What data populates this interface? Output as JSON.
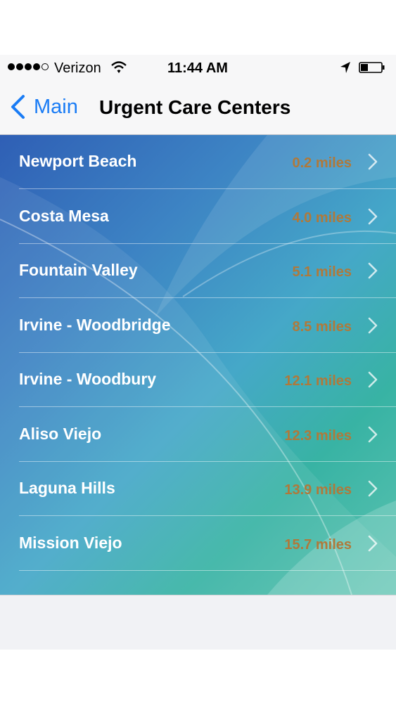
{
  "status_bar": {
    "carrier": "Verizon",
    "time": "11:44 AM",
    "signal_bars": 4,
    "icons": [
      "signal-icon",
      "wifi-icon",
      "location-arrow-icon",
      "battery-icon"
    ]
  },
  "nav": {
    "back_label": "Main",
    "title": "Urgent Care Centers"
  },
  "colors": {
    "accent": "#1a7cf5",
    "distance": "#b0793a",
    "row_text": "#ffffff"
  },
  "locations": [
    {
      "name": "Newport Beach",
      "distance": "0.2 miles"
    },
    {
      "name": "Costa Mesa",
      "distance": "4.0 miles"
    },
    {
      "name": "Fountain Valley",
      "distance": "5.1 miles"
    },
    {
      "name": "Irvine - Woodbridge",
      "distance": "8.5 miles"
    },
    {
      "name": "Irvine - Woodbury",
      "distance": "12.1 miles"
    },
    {
      "name": "Aliso Viejo",
      "distance": "12.3 miles"
    },
    {
      "name": "Laguna Hills",
      "distance": "13.9 miles"
    },
    {
      "name": "Mission Viejo",
      "distance": "15.7 miles"
    }
  ]
}
